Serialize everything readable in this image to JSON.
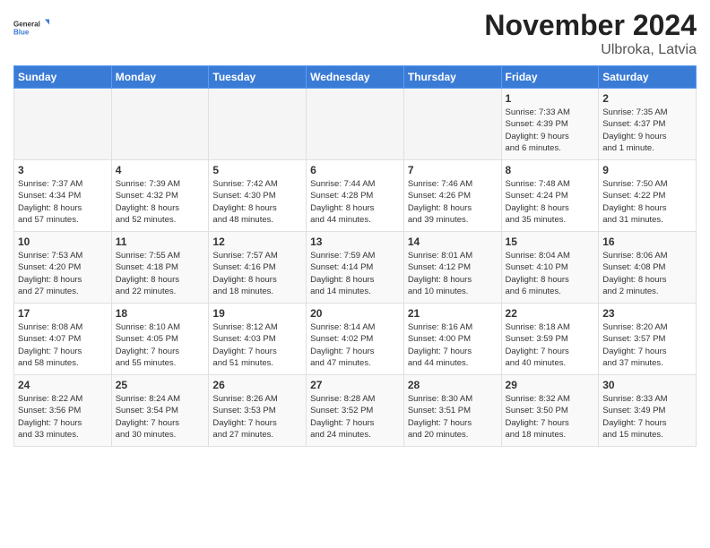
{
  "header": {
    "logo_line1": "General",
    "logo_line2": "Blue",
    "month": "November 2024",
    "location": "Ulbroka, Latvia"
  },
  "weekdays": [
    "Sunday",
    "Monday",
    "Tuesday",
    "Wednesday",
    "Thursday",
    "Friday",
    "Saturday"
  ],
  "weeks": [
    [
      {
        "day": "",
        "info": ""
      },
      {
        "day": "",
        "info": ""
      },
      {
        "day": "",
        "info": ""
      },
      {
        "day": "",
        "info": ""
      },
      {
        "day": "",
        "info": ""
      },
      {
        "day": "1",
        "info": "Sunrise: 7:33 AM\nSunset: 4:39 PM\nDaylight: 9 hours\nand 6 minutes."
      },
      {
        "day": "2",
        "info": "Sunrise: 7:35 AM\nSunset: 4:37 PM\nDaylight: 9 hours\nand 1 minute."
      }
    ],
    [
      {
        "day": "3",
        "info": "Sunrise: 7:37 AM\nSunset: 4:34 PM\nDaylight: 8 hours\nand 57 minutes."
      },
      {
        "day": "4",
        "info": "Sunrise: 7:39 AM\nSunset: 4:32 PM\nDaylight: 8 hours\nand 52 minutes."
      },
      {
        "day": "5",
        "info": "Sunrise: 7:42 AM\nSunset: 4:30 PM\nDaylight: 8 hours\nand 48 minutes."
      },
      {
        "day": "6",
        "info": "Sunrise: 7:44 AM\nSunset: 4:28 PM\nDaylight: 8 hours\nand 44 minutes."
      },
      {
        "day": "7",
        "info": "Sunrise: 7:46 AM\nSunset: 4:26 PM\nDaylight: 8 hours\nand 39 minutes."
      },
      {
        "day": "8",
        "info": "Sunrise: 7:48 AM\nSunset: 4:24 PM\nDaylight: 8 hours\nand 35 minutes."
      },
      {
        "day": "9",
        "info": "Sunrise: 7:50 AM\nSunset: 4:22 PM\nDaylight: 8 hours\nand 31 minutes."
      }
    ],
    [
      {
        "day": "10",
        "info": "Sunrise: 7:53 AM\nSunset: 4:20 PM\nDaylight: 8 hours\nand 27 minutes."
      },
      {
        "day": "11",
        "info": "Sunrise: 7:55 AM\nSunset: 4:18 PM\nDaylight: 8 hours\nand 22 minutes."
      },
      {
        "day": "12",
        "info": "Sunrise: 7:57 AM\nSunset: 4:16 PM\nDaylight: 8 hours\nand 18 minutes."
      },
      {
        "day": "13",
        "info": "Sunrise: 7:59 AM\nSunset: 4:14 PM\nDaylight: 8 hours\nand 14 minutes."
      },
      {
        "day": "14",
        "info": "Sunrise: 8:01 AM\nSunset: 4:12 PM\nDaylight: 8 hours\nand 10 minutes."
      },
      {
        "day": "15",
        "info": "Sunrise: 8:04 AM\nSunset: 4:10 PM\nDaylight: 8 hours\nand 6 minutes."
      },
      {
        "day": "16",
        "info": "Sunrise: 8:06 AM\nSunset: 4:08 PM\nDaylight: 8 hours\nand 2 minutes."
      }
    ],
    [
      {
        "day": "17",
        "info": "Sunrise: 8:08 AM\nSunset: 4:07 PM\nDaylight: 7 hours\nand 58 minutes."
      },
      {
        "day": "18",
        "info": "Sunrise: 8:10 AM\nSunset: 4:05 PM\nDaylight: 7 hours\nand 55 minutes."
      },
      {
        "day": "19",
        "info": "Sunrise: 8:12 AM\nSunset: 4:03 PM\nDaylight: 7 hours\nand 51 minutes."
      },
      {
        "day": "20",
        "info": "Sunrise: 8:14 AM\nSunset: 4:02 PM\nDaylight: 7 hours\nand 47 minutes."
      },
      {
        "day": "21",
        "info": "Sunrise: 8:16 AM\nSunset: 4:00 PM\nDaylight: 7 hours\nand 44 minutes."
      },
      {
        "day": "22",
        "info": "Sunrise: 8:18 AM\nSunset: 3:59 PM\nDaylight: 7 hours\nand 40 minutes."
      },
      {
        "day": "23",
        "info": "Sunrise: 8:20 AM\nSunset: 3:57 PM\nDaylight: 7 hours\nand 37 minutes."
      }
    ],
    [
      {
        "day": "24",
        "info": "Sunrise: 8:22 AM\nSunset: 3:56 PM\nDaylight: 7 hours\nand 33 minutes."
      },
      {
        "day": "25",
        "info": "Sunrise: 8:24 AM\nSunset: 3:54 PM\nDaylight: 7 hours\nand 30 minutes."
      },
      {
        "day": "26",
        "info": "Sunrise: 8:26 AM\nSunset: 3:53 PM\nDaylight: 7 hours\nand 27 minutes."
      },
      {
        "day": "27",
        "info": "Sunrise: 8:28 AM\nSunset: 3:52 PM\nDaylight: 7 hours\nand 24 minutes."
      },
      {
        "day": "28",
        "info": "Sunrise: 8:30 AM\nSunset: 3:51 PM\nDaylight: 7 hours\nand 20 minutes."
      },
      {
        "day": "29",
        "info": "Sunrise: 8:32 AM\nSunset: 3:50 PM\nDaylight: 7 hours\nand 18 minutes."
      },
      {
        "day": "30",
        "info": "Sunrise: 8:33 AM\nSunset: 3:49 PM\nDaylight: 7 hours\nand 15 minutes."
      }
    ]
  ]
}
